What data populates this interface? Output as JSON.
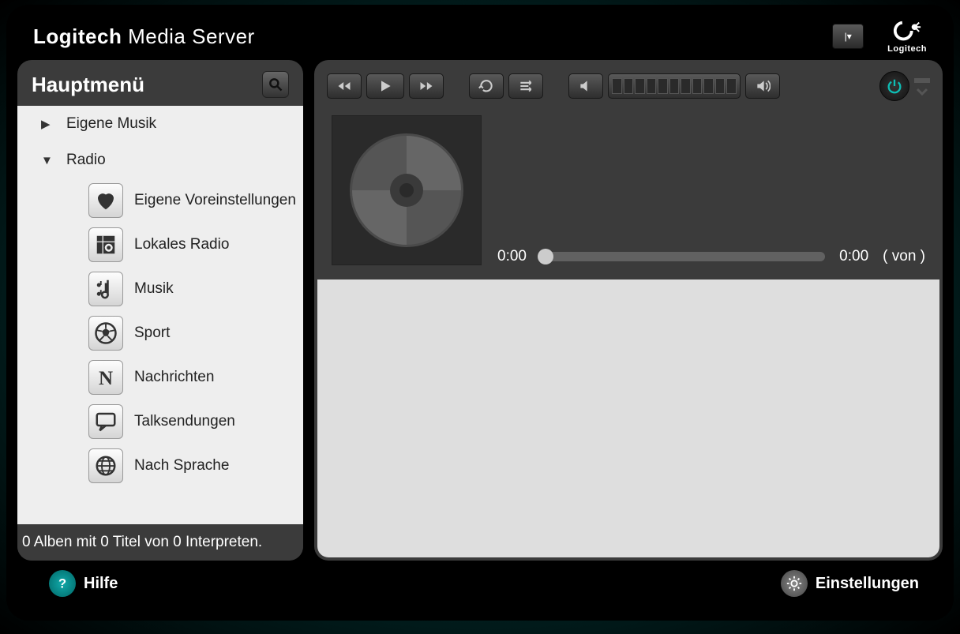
{
  "header": {
    "brand_logi": "Logitech",
    "brand_ms": "Media Server",
    "logo_text": "Logitech"
  },
  "sidebar": {
    "title": "Hauptmenü",
    "items": [
      {
        "label": "Eigene Musik",
        "expanded": false
      },
      {
        "label": "Radio",
        "expanded": true
      }
    ],
    "radio_children": [
      {
        "label": "Eigene Voreinstellungen"
      },
      {
        "label": "Lokales Radio"
      },
      {
        "label": "Musik"
      },
      {
        "label": "Sport"
      },
      {
        "label": "Nachrichten"
      },
      {
        "label": "Talksendungen"
      },
      {
        "label": "Nach Sprache"
      }
    ],
    "status": "0 Alben mit 0 Titel von 0 Interpreten."
  },
  "player": {
    "elapsed": "0:00",
    "total": "0:00",
    "of_label": "( von )"
  },
  "footer": {
    "help": "Hilfe",
    "settings": "Einstellungen"
  }
}
